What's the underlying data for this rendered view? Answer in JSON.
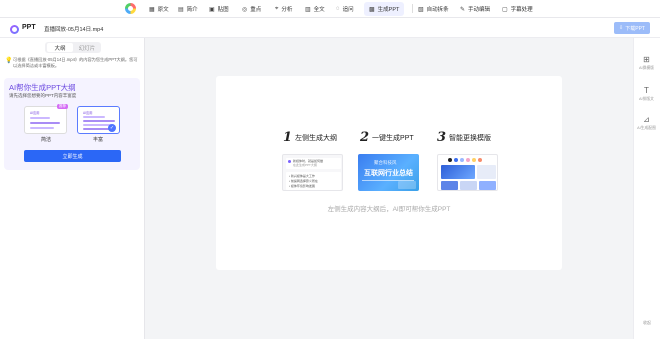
{
  "topnav": {
    "items": [
      {
        "icon": "▦",
        "icon_name": "document-icon",
        "label": "原文"
      },
      {
        "icon": "▤",
        "icon_name": "summary-icon",
        "label": "简介"
      },
      {
        "icon": "▣",
        "icon_name": "image-icon",
        "label": "贴图"
      },
      {
        "icon": "◎",
        "icon_name": "keypoint-icon",
        "label": "重点"
      },
      {
        "icon": "⌖",
        "icon_name": "analysis-icon",
        "label": "分析"
      },
      {
        "icon": "▥",
        "icon_name": "fulltext-icon",
        "label": "全文"
      },
      {
        "icon": "◌",
        "icon_name": "qa-icon",
        "label": "追问"
      },
      {
        "icon": "▩",
        "icon_name": "ppt-icon",
        "label": "生成PPT",
        "active": true
      },
      {
        "icon": "▧",
        "icon_name": "mindmap-icon",
        "label": "自动拆条"
      },
      {
        "icon": "✎",
        "icon_name": "edit-icon",
        "label": "手动编辑"
      },
      {
        "icon": "▢",
        "icon_name": "subtitle-icon",
        "label": "字幕处理"
      }
    ]
  },
  "header": {
    "app_label": "PPT",
    "doc_title": "直播回放-05月14日.mp4",
    "download_label": "下载PPT"
  },
  "left": {
    "tabs": [
      "大纲",
      "幻灯片"
    ],
    "tip": "可根据《直播回放-05月14日.mp4》的内容为您生成PPT大纲。您可以选择简洁或丰富模板。",
    "gen_title": "AI帮你生成PPT大纲",
    "gen_subtitle": "请先选择您想要的PPT内容丰富度",
    "options": [
      {
        "label": "简洁",
        "tag": "AI应用",
        "selected": false
      },
      {
        "label": "丰富",
        "tag": "AI应用",
        "selected": true
      }
    ],
    "rec_badge": "推荐",
    "generate_label": "立即生成"
  },
  "center": {
    "steps": [
      {
        "num": "1",
        "text": "左侧生成大纲"
      },
      {
        "num": "2",
        "text": "一键生成PPT"
      },
      {
        "num": "3",
        "text": "智能更换模版"
      }
    ],
    "thumb1": {
      "line1": "新媒体时，就是如何做",
      "line2": "在此生成PPT大纲",
      "items": [
        "• 新兴媒体是大工作",
        "• 前提网选择意义所在",
        "• 媒体环境影响发展"
      ]
    },
    "thumb2": {
      "small": "聚合科技风",
      "big": "互联网行业总结"
    },
    "caption": "左侧生成内容大纲后，AI即可帮你生成PPT"
  },
  "rail": {
    "items": [
      {
        "icon": "⊞",
        "icon_name": "template-icon",
        "label": "AI换模版"
      },
      {
        "icon": "T",
        "icon_name": "text-icon",
        "label": "AI排版文"
      },
      {
        "icon": "⊿",
        "icon_name": "draw-icon",
        "label": "AI生成配图"
      }
    ],
    "corner": "收起"
  }
}
